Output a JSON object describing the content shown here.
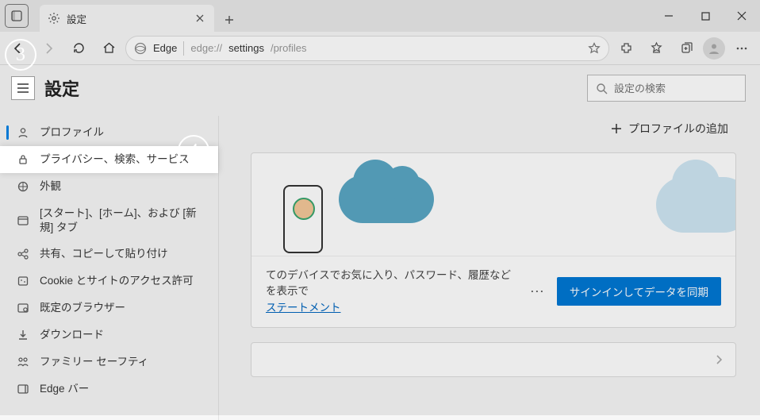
{
  "tab": {
    "title": "設定"
  },
  "address": {
    "scheme_label": "Edge",
    "url_dim": "edge://",
    "url_mid": "settings",
    "url_tail": "/profiles"
  },
  "settings": {
    "title": "設定",
    "search_placeholder": "設定の検索"
  },
  "sidebar": {
    "items": [
      {
        "label": "プロファイル"
      },
      {
        "label": "プライバシー、検索、サービス"
      },
      {
        "label": "外観"
      },
      {
        "label": "[スタート]、[ホーム]、および [新規] タブ"
      },
      {
        "label": "共有、コピーして貼り付け"
      },
      {
        "label": "Cookie とサイトのアクセス許可"
      },
      {
        "label": "既定のブラウザー"
      },
      {
        "label": "ダウンロード"
      },
      {
        "label": "ファミリー セーフティ"
      },
      {
        "label": "Edge バー"
      }
    ]
  },
  "main": {
    "add_profile": "プロファイルの追加",
    "sync_text": "てのデバイスでお気に入り、パスワード、履歴などを表示で",
    "sync_link": "ステートメント",
    "sync_button": "サインインしてデータを同期"
  },
  "annotations": {
    "n3": "3",
    "n4": "4"
  }
}
